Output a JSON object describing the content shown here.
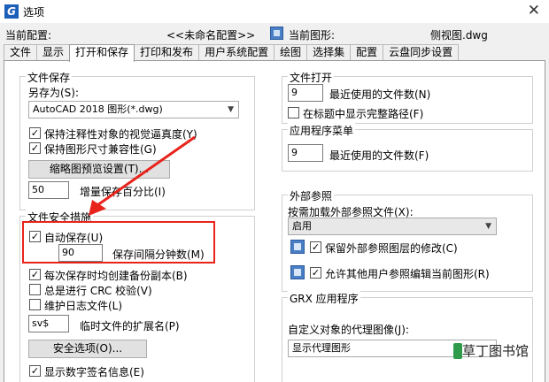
{
  "window": {
    "title": "选项",
    "close_label": "✕"
  },
  "config": {
    "current_config_label": "当前配置:",
    "current_config_value": "<<未命名配置>>",
    "current_drawing_label": "当前图形:",
    "current_drawing_value": "侧视图.dwg"
  },
  "tabs": [
    "文件",
    "显示",
    "打开和保存",
    "打印和发布",
    "用户系统配置",
    "绘图",
    "选择集",
    "配置",
    "云盘同步设置"
  ],
  "file_save": {
    "group_title": "文件保存",
    "save_as_label": "另存为(S):",
    "save_as_value": "AutoCAD 2018 图形(*.dwg)",
    "keep_visual_fidelity": "保持注释性对象的视觉逼真度(Y)",
    "keep_dimension_compat": "保持图形尺寸兼容性(G)",
    "thumbnail_button": "缩略图预览设置(T)...",
    "incremental_value": "50",
    "incremental_label": "增量保存百分比(I)"
  },
  "safety": {
    "group_title": "文件安全措施",
    "autosave_label": "自动保存(U)",
    "interval_value": "90",
    "interval_label": "保存间隔分钟数(M)",
    "backup_label": "每次保存时均创建备份副本(B)",
    "crc_label": "总是进行 CRC 校验(V)",
    "log_label": "维护日志文件(L)",
    "ext_value": "sv$",
    "ext_label": "临时文件的扩展名(P)",
    "security_button": "安全选项(O)...",
    "digital_signature_label": "显示数字签名信息(E)"
  },
  "file_open": {
    "group_title": "文件打开",
    "recent_value": "9",
    "recent_label": "最近使用的文件数(N)",
    "fullpath_label": "在标题中显示完整路径(F)"
  },
  "app_menu": {
    "group_title": "应用程序菜单",
    "recent_value": "9",
    "recent_label": "最近使用的文件数(F)"
  },
  "xref": {
    "group_title": "外部参照",
    "demand_load_label": "按需加载外部参照文件(X):",
    "demand_load_value": "启用",
    "retain_layer_label": "保留外部参照图层的修改(C)",
    "allow_edit_label": "允许其他用户参照编辑当前图形(R)"
  },
  "grx": {
    "group_title": "GRX 应用程序",
    "proxy_label": "自定义对象的代理图像(J):",
    "proxy_value": "显示代理图形"
  },
  "watermark": {
    "text": "草丁图书馆"
  }
}
